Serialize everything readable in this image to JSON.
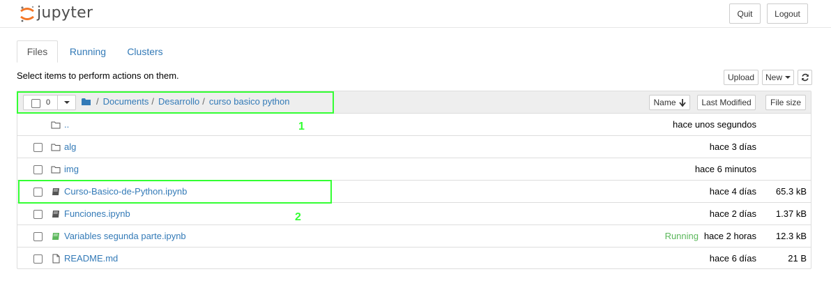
{
  "header": {
    "logo_text": "jupyter",
    "quit_label": "Quit",
    "logout_label": "Logout",
    "logo_color": "#f37626"
  },
  "tabs": [
    {
      "label": "Files",
      "active": true
    },
    {
      "label": "Running",
      "active": false
    },
    {
      "label": "Clusters",
      "active": false
    }
  ],
  "toolbar": {
    "hint": "Select items to perform actions on them.",
    "upload_label": "Upload",
    "new_label": "New",
    "refresh_icon": "refresh-icon"
  },
  "list_header": {
    "selected_count": "0",
    "breadcrumb": [
      "/",
      "Documents",
      "/",
      "Desarrollo",
      "/",
      "curso basico python"
    ],
    "sort_name_label": "Name",
    "sort_modified_label": "Last Modified",
    "sort_size_label": "File size"
  },
  "files": [
    {
      "name": "..",
      "type": "folder",
      "modified": "hace unos segundos",
      "size": "",
      "running": ""
    },
    {
      "name": "alg",
      "type": "folder",
      "modified": "hace 3 días",
      "size": "",
      "running": ""
    },
    {
      "name": "img",
      "type": "folder",
      "modified": "hace 6 minutos",
      "size": "",
      "running": ""
    },
    {
      "name": "Curso-Basico-de-Python.ipynb",
      "type": "notebook",
      "modified": "hace 4 días",
      "size": "65.3 kB",
      "running": ""
    },
    {
      "name": "Funciones.ipynb",
      "type": "notebook",
      "modified": "hace 2 días",
      "size": "1.37 kB",
      "running": ""
    },
    {
      "name": "Variables segunda parte.ipynb",
      "type": "notebook-running",
      "modified": "hace 2 horas",
      "size": "12.3 kB",
      "running": "Running"
    },
    {
      "name": "README.md",
      "type": "file",
      "modified": "hace 6 días",
      "size": "21 B",
      "running": ""
    }
  ],
  "annotations": {
    "label_1": "1",
    "label_2": "2",
    "color": "#33ff33"
  }
}
